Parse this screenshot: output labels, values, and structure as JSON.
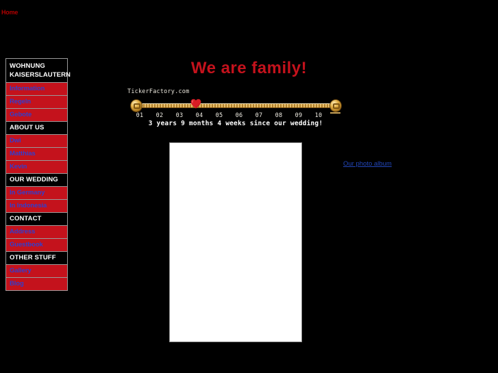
{
  "top_nav": {
    "home_label": "Home"
  },
  "sidebar": {
    "sections": [
      {
        "header": "WOHNUNG KAISERSLAUTERN",
        "header_line1": "WOHNUNG",
        "header_line2": "KAISERSLAUTERN",
        "items": [
          "Information",
          "Regeln",
          "Gebote"
        ]
      },
      {
        "header": "ABOUT US",
        "items": [
          "Dwi",
          "Matthias",
          "Kevin"
        ]
      },
      {
        "header": "OUR WEDDING",
        "items": [
          "In Germany",
          "In Indonesia"
        ]
      },
      {
        "header": "CONTACT",
        "items": [
          "Address",
          "Guestbook"
        ]
      },
      {
        "header": "OTHER STUFF",
        "items": [
          "Gallery",
          "Blog"
        ]
      }
    ]
  },
  "main": {
    "title": "We are family!",
    "photo_album_link": "Our photo album"
  },
  "ticker": {
    "brand": "TickerFactory.com",
    "caption": "3 years 9 months 4 weeks since our wedding!",
    "scale_labels": [
      "01",
      "02",
      "03",
      "04",
      "05",
      "06",
      "07",
      "08",
      "09",
      "10"
    ],
    "marker_label": "heart-charm"
  },
  "colors": {
    "background": "#000000",
    "accent_red": "#c4121c",
    "title_red": "#c4121c",
    "link_blue": "#2f3fd0",
    "album_link_blue": "#2246b9",
    "border_gray": "#9a9a9a",
    "header_text": "#ffffff"
  }
}
